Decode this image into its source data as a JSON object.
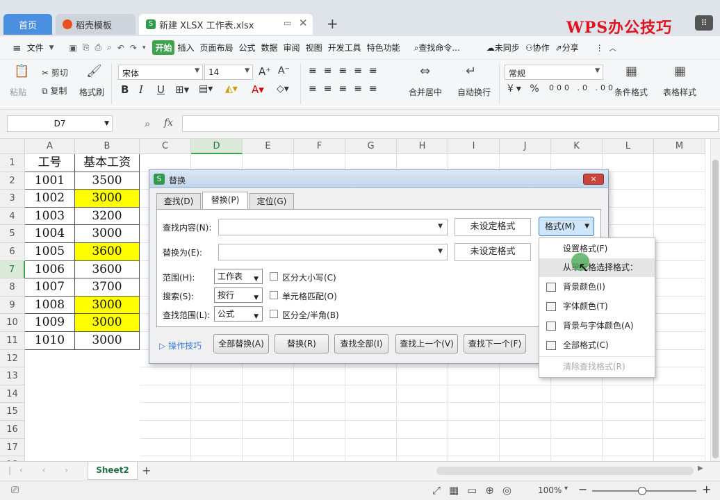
{
  "tabs": {
    "home": "首页",
    "template": "稻壳模板",
    "file": "新建 XLSX 工作表.xlsx",
    "add": "+"
  },
  "brand": "WPS办公技巧",
  "menu": {
    "file": "文件",
    "items": [
      "开始",
      "插入",
      "页面布局",
      "公式",
      "数据",
      "审阅",
      "视图",
      "开发工具",
      "特色功能"
    ],
    "search": "查找命令...",
    "sync": "未同步",
    "collab": "协作",
    "share": "分享"
  },
  "ribbon": {
    "paste": "粘贴",
    "cut": "剪切",
    "copy": "复制",
    "format_painter": "格式刷",
    "font": "宋体",
    "size": "14",
    "merge": "合并居中",
    "wrap": "自动换行",
    "number_format": "常规",
    "cond_format": "条件格式",
    "table_style": "表格样式"
  },
  "formula": {
    "cell_ref": "D7",
    "fx": "fx"
  },
  "grid": {
    "columns": [
      "A",
      "B",
      "C",
      "D",
      "E",
      "F",
      "G",
      "H",
      "I",
      "J",
      "K",
      "L",
      "M"
    ],
    "rows": [
      "1",
      "2",
      "3",
      "4",
      "5",
      "6",
      "7",
      "8",
      "9",
      "10",
      "11",
      "12",
      "13",
      "14",
      "15",
      "16",
      "17",
      "18"
    ],
    "header": [
      "工号",
      "基本工资"
    ],
    "data": [
      [
        "1001",
        "3500"
      ],
      [
        "1002",
        "3000"
      ],
      [
        "1003",
        "3200"
      ],
      [
        "1004",
        "3000"
      ],
      [
        "1005",
        "3600"
      ],
      [
        "1006",
        "3600"
      ],
      [
        "1007",
        "3700"
      ],
      [
        "1008",
        "3000"
      ],
      [
        "1009",
        "3000"
      ],
      [
        "1010",
        "3000"
      ]
    ],
    "highlight_color": "#ffff00"
  },
  "sheet": {
    "name": "Sheet2",
    "add": "+"
  },
  "status": {
    "zoom": "100%"
  },
  "dialog": {
    "title": "替换",
    "close": "×",
    "tabs": [
      "查找(D)",
      "替换(P)",
      "定位(G)"
    ],
    "find_label": "查找内容(N):",
    "replace_label": "替换为(E):",
    "no_format_1": "未设定格式",
    "no_format_2": "未设定格式",
    "format_button": "格式(M)",
    "range_label": "范围(H):",
    "range_value": "工作表",
    "search_label": "搜索(S):",
    "search_value": "按行",
    "lookin_label": "查找范围(L):",
    "lookin_value": "公式",
    "match_case": "区分大小写(C)",
    "match_cell": "单元格匹配(O)",
    "match_width": "区分全/半角(B)",
    "tips": "操作技巧",
    "buttons": [
      "全部替换(A)",
      "替换(R)",
      "查找全部(I)",
      "查找上一个(V)",
      "查找下一个(F)"
    ]
  },
  "format_menu": {
    "set_format": "设置格式(F)",
    "from_cell": "从单元格选择格式：",
    "bg_color": "背景颜色(I)",
    "font_color": "字体颜色(T)",
    "bg_font_color": "背景与字体颜色(A)",
    "all_format": "全部格式(C)",
    "clear": "清除查找格式(R)"
  }
}
